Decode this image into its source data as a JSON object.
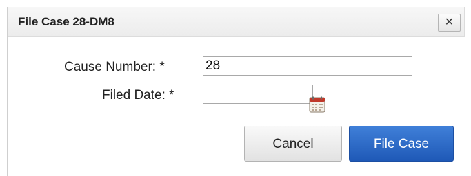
{
  "dialog": {
    "title": "File Case 28-DM8",
    "close_glyph": "✕",
    "close_icon": "close-icon"
  },
  "form": {
    "cause_number": {
      "label": "Cause Number:",
      "required_marker": "*",
      "value": "28"
    },
    "filed_date": {
      "label": "Filed Date:",
      "required_marker": "*",
      "value": "",
      "icon": "calendar-icon"
    }
  },
  "buttons": {
    "cancel_label": "Cancel",
    "submit_label": "File Case"
  },
  "colors": {
    "primary_button": "#2a67c6",
    "calendar_accent": "#c0392b"
  }
}
